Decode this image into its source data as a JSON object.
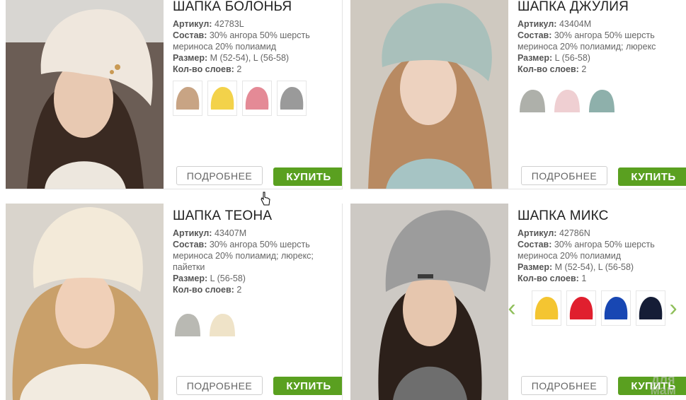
{
  "colors": {
    "buy_button": "#5aa020",
    "swatch_border": "#e6e6e6",
    "text": "#666666",
    "arrow": "#8fbf5a"
  },
  "labels": {
    "article": "Артикул:",
    "composition": "Состав:",
    "size": "Размер:",
    "layers": "Кол-во слоев:"
  },
  "buttons": {
    "more": "ПОДРОБНЕЕ",
    "buy": "КУПИТЬ"
  },
  "products": [
    {
      "title": "ШАПКА БОЛОНЬЯ",
      "article": "42783L",
      "composition_line1": "30% ангора 50% шерсть",
      "composition_line2": "мериноса 20% полиамид",
      "composition_line3": "",
      "size": "M (52-54), L (56-58)",
      "layers": "2",
      "hat_color": "#efe7dd",
      "swatches": [
        "#c8a484",
        "#f3d24a",
        "#e48a96",
        "#9a9a9a"
      ]
    },
    {
      "title": "ШАПКА ДЖУЛИЯ",
      "article": "43404M",
      "composition_line1": "30% ангора 50% шерсть",
      "composition_line2": "мериноса 20% полиамид; люрекс",
      "composition_line3": "",
      "size": "L (56-58)",
      "layers": "2",
      "hat_color": "#a9c0bb",
      "swatches": [
        "#aeb0aa",
        "#efcfd2",
        "#8eb0ab"
      ]
    },
    {
      "title": "ШАПКА ТЕОНА",
      "article": "43407M",
      "composition_line1": "30% ангора 50% шерсть",
      "composition_line2": "мериноса 20% полиамид; люрекс;",
      "composition_line3": "пайетки",
      "size": "L (56-58)",
      "layers": "2",
      "hat_color": "#f3ead9",
      "swatches": [
        "#b9b9b3",
        "#efe3c8"
      ]
    },
    {
      "title": "ШАПКА МИКС",
      "article": "42786N",
      "composition_line1": "30% ангора 50% шерсть",
      "composition_line2": "мериноса 20% полиамид",
      "composition_line3": "",
      "size": "M (52-54), L (56-58)",
      "layers": "1",
      "hat_color": "#9c9c9c",
      "swatches": [
        "#f4c531",
        "#e01f2e",
        "#1847b3",
        "#151d36"
      ]
    }
  ],
  "watermark": {
    "line1": "для",
    "line2": "мам"
  }
}
